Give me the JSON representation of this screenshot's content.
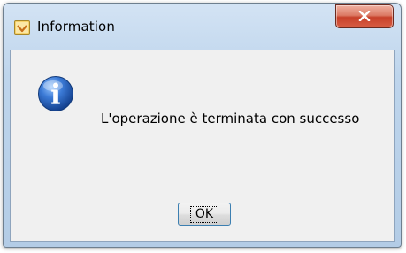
{
  "window": {
    "title": "Information",
    "title_icon": "information-window-icon",
    "close_icon": "close-icon"
  },
  "dialog": {
    "icon": "info-icon",
    "message": "L'operazione è terminata con successo",
    "ok_label": "OK"
  },
  "colors": {
    "title_bar": "#bed5ec",
    "close_button": "#c7402a",
    "dialog_background": "#f0f0f0",
    "info_icon": "#2a63b8"
  }
}
